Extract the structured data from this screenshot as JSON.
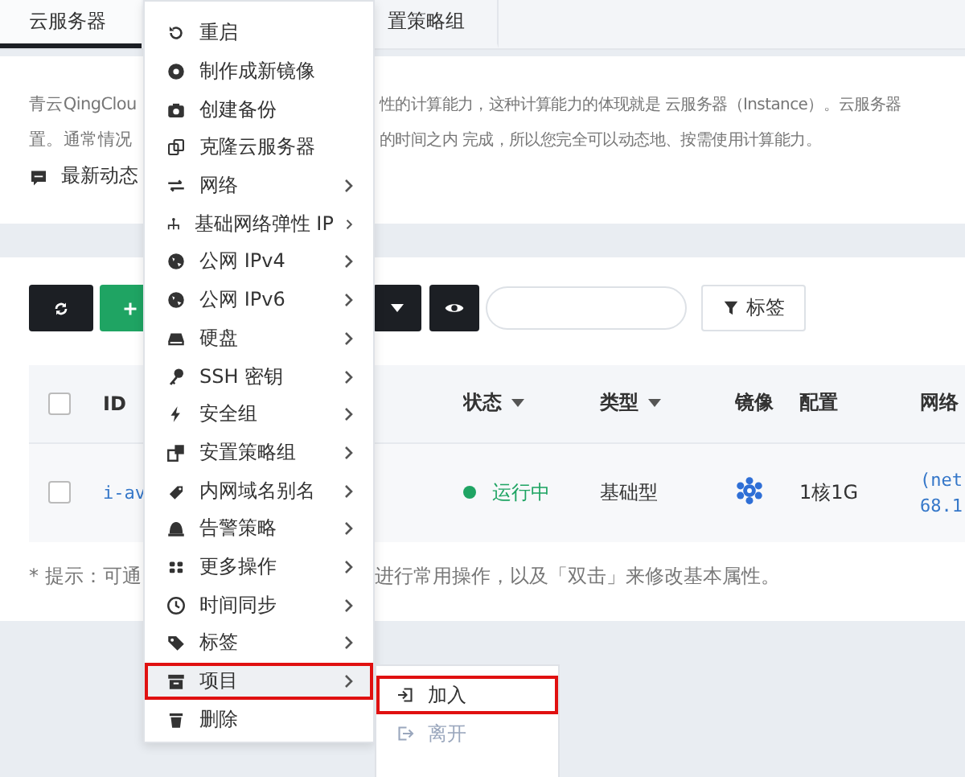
{
  "tabs": [
    {
      "label": "云服务器",
      "selected": true
    },
    {
      "label": "置策略组",
      "selected": false
    }
  ],
  "description": {
    "lines": [
      {
        "left": "青云QingClou",
        "right": "性的计算能力，这种计算能力的体现就是 云服务器（Instance）。云服务器"
      },
      {
        "left": "置。通常情况",
        "right": "的时间之内 完成，所以您完全可以动态地、按需使用计算能力。"
      }
    ],
    "news_link": "最新动态"
  },
  "toolbar": {
    "tag_filter": "标签"
  },
  "table": {
    "header_checked": false,
    "columns": [
      "ID",
      "状态",
      "类型",
      "镜像",
      "配置",
      "网络"
    ],
    "sortable": [
      false,
      true,
      true,
      false,
      false,
      false
    ],
    "rows": [
      {
        "checked": false,
        "id": "i-av",
        "status": "运行中",
        "running": true,
        "type": "基础型",
        "config": "1核1G",
        "network": [
          "(net",
          "68.1"
        ]
      }
    ]
  },
  "hint": {
    "left": "* 提示：可通",
    "right": "进行常用操作，以及「双击」来修改基本属性。"
  },
  "context_menu": {
    "items": [
      {
        "label": "重启",
        "submenu": false,
        "selected": false,
        "annotated": false
      },
      {
        "label": "制作成新镜像",
        "submenu": false,
        "selected": false,
        "annotated": false
      },
      {
        "label": "创建备份",
        "submenu": false,
        "selected": false,
        "annotated": false
      },
      {
        "label": "克隆云服务器",
        "submenu": false,
        "selected": false,
        "annotated": false
      },
      {
        "label": "网络",
        "submenu": true,
        "selected": false,
        "annotated": false
      },
      {
        "label": "基础网络弹性 IP",
        "submenu": true,
        "selected": false,
        "annotated": false
      },
      {
        "label": "公网 IPv4",
        "submenu": true,
        "selected": false,
        "annotated": false
      },
      {
        "label": "公网 IPv6",
        "submenu": true,
        "selected": false,
        "annotated": false
      },
      {
        "label": "硬盘",
        "submenu": true,
        "selected": false,
        "annotated": false
      },
      {
        "label": "SSH 密钥",
        "submenu": true,
        "selected": false,
        "annotated": false
      },
      {
        "label": "安全组",
        "submenu": true,
        "selected": false,
        "annotated": false
      },
      {
        "label": "安置策略组",
        "submenu": true,
        "selected": false,
        "annotated": false
      },
      {
        "label": "内网域名别名",
        "submenu": true,
        "selected": false,
        "annotated": false
      },
      {
        "label": "告警策略",
        "submenu": true,
        "selected": false,
        "annotated": false
      },
      {
        "label": "更多操作",
        "submenu": true,
        "selected": false,
        "annotated": false
      },
      {
        "label": "时间同步",
        "submenu": true,
        "selected": false,
        "annotated": false
      },
      {
        "label": "标签",
        "submenu": true,
        "selected": false,
        "annotated": false
      },
      {
        "label": "项目",
        "submenu": true,
        "selected": true,
        "annotated": true
      },
      {
        "label": "删除",
        "submenu": false,
        "selected": false,
        "annotated": false
      }
    ],
    "submenu_items": [
      {
        "label": "加入",
        "disabled": false,
        "annotated": true
      },
      {
        "label": "离开",
        "disabled": true,
        "annotated": false
      }
    ]
  }
}
